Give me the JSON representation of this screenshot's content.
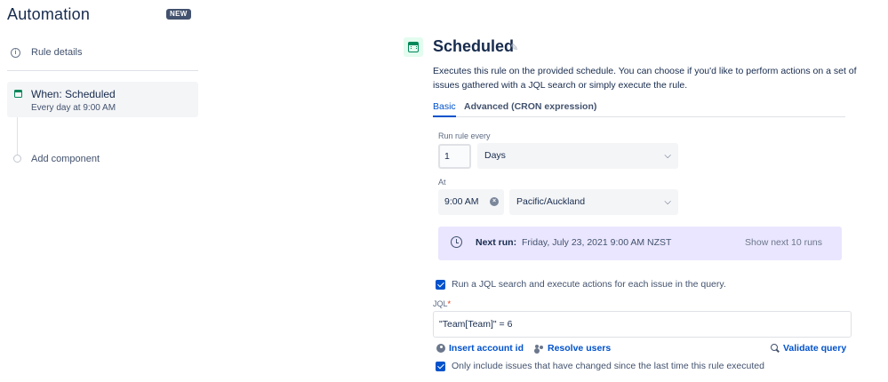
{
  "sidebar": {
    "title": "Automation",
    "badge": "NEW",
    "rule_details": "Rule details",
    "trigger": {
      "title": "When: Scheduled",
      "subtitle": "Every day at 9:00 AM"
    },
    "add_component": "Add component"
  },
  "main": {
    "title": "Scheduled",
    "description": "Executes this rule on the provided schedule. You can choose if you'd like to perform actions on a set of issues gathered with a JQL search or simply execute the rule.",
    "tabs": [
      {
        "label": "Basic",
        "active": true
      },
      {
        "label": "Advanced (CRON expression)",
        "active": false
      }
    ],
    "run_every": {
      "label": "Run rule every",
      "value": "1",
      "unit": "Days"
    },
    "at": {
      "label": "At",
      "time": "9:00 AM",
      "timezone": "Pacific/Auckland"
    },
    "next_run": {
      "label": "Next run:",
      "value": "Friday, July 23, 2021 9:00 AM NZST",
      "show_next": "Show next 10 runs"
    },
    "jql_checkbox": {
      "label": "Run a JQL search and execute actions for each issue in the query.",
      "checked": true
    },
    "jql": {
      "label": "JQL",
      "required_mark": "*",
      "value": "\"Team[Team]\" = 6"
    },
    "links": {
      "insert_account_id": "Insert account id",
      "resolve_users": "Resolve users",
      "validate_query": "Validate query"
    },
    "only_changed_checkbox": {
      "label": "Only include issues that have changed since the last time this rule executed",
      "checked": true
    }
  },
  "colors": {
    "accent": "#0052cc",
    "schedule_green": "#00875a",
    "next_run_bg": "#eae6ff",
    "badge_bg": "#42526e"
  }
}
